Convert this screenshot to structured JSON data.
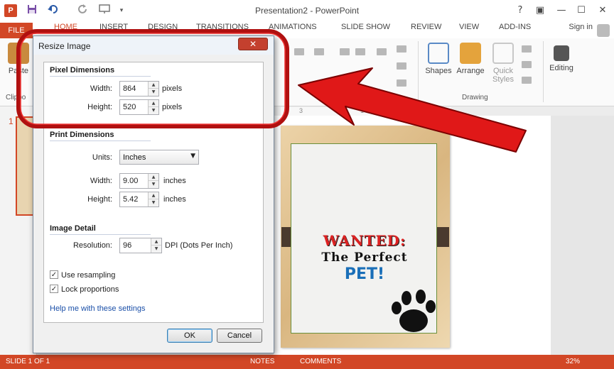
{
  "app": {
    "logo": "P",
    "title": "Presentation2 - PowerPoint",
    "help_icon": "?",
    "restore_icon": "▣",
    "minimize_icon": "—",
    "maximize_icon": "☐",
    "close_icon": "✕"
  },
  "quick_access": {
    "save_icon": "save-icon",
    "undo_icon": "undo-icon",
    "redo_icon": "redo-icon",
    "present_icon": "present-icon"
  },
  "tabs": {
    "file": "FILE",
    "home": "HOME",
    "insert": "INSERT",
    "design": "DESIGN",
    "transitions": "TRANSITIONS",
    "animations": "ANIMATIONS",
    "slideshow": "SLIDE SHOW",
    "review": "REVIEW",
    "view": "VIEW",
    "addins": "ADD-INS",
    "signin": "Sign in"
  },
  "ribbon": {
    "paste": "Paste",
    "clipboard": "Clipbo",
    "shapes": "Shapes",
    "arrange": "Arrange",
    "quick_styles_1": "Quick",
    "quick_styles_2": "Styles",
    "drawing": "Drawing",
    "editing": "Editing"
  },
  "ruler": {
    "t1": "3",
    "t2": "1",
    "t3": "2"
  },
  "slides": {
    "current": "1"
  },
  "poster": {
    "line1": "WANTED:",
    "line2": "The Perfect",
    "line3": "PET!"
  },
  "dialog": {
    "title": "Resize Image",
    "close": "✕",
    "pixel_dimensions": {
      "heading": "Pixel Dimensions",
      "width_label": "Width:",
      "width_value": "864",
      "width_unit": "pixels",
      "height_label": "Height:",
      "height_value": "520",
      "height_unit": "pixels"
    },
    "print_dimensions": {
      "heading": "Print Dimensions",
      "units_label": "Units:",
      "units_value": "Inches",
      "width_label": "Width:",
      "width_value": "9.00",
      "width_unit": "inches",
      "height_label": "Height:",
      "height_value": "5.42",
      "height_unit": "inches"
    },
    "image_detail": {
      "heading": "Image Detail",
      "resolution_label": "Resolution:",
      "resolution_value": "96",
      "resolution_unit": "DPI (Dots Per Inch)"
    },
    "use_resampling": "Use resampling",
    "lock_proportions": "Lock proportions",
    "help_link": "Help me with these settings",
    "ok": "OK",
    "cancel": "Cancel",
    "check_mark": "✓",
    "spin_up": "▲",
    "spin_down": "▼",
    "dropdown_arrow": "▼"
  },
  "status": {
    "slide": "SLIDE 1 OF 1",
    "notes": "NOTES",
    "comments": "COMMENTS",
    "zoom": "32%"
  },
  "colors": {
    "accent": "#d24726",
    "highlight_red": "#cc1111",
    "link": "#1a4fa8"
  }
}
